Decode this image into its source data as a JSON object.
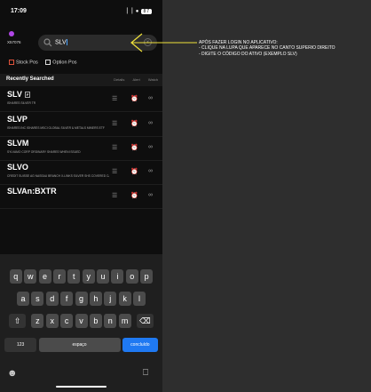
{
  "status": {
    "time": "17:09",
    "signal": "▕▕ ●",
    "battery": "87"
  },
  "account": {
    "number": "X57076"
  },
  "search": {
    "value": "SLV",
    "clear": "×"
  },
  "tabs": [
    {
      "label": "Stock Pos"
    },
    {
      "label": "Option Pos"
    }
  ],
  "recent": {
    "title": "Recently Searched",
    "col_details": "Details",
    "col_alert": "Alert",
    "col_watch": "Watch"
  },
  "rows": [
    {
      "symbol": "SLV",
      "desc": "ISHARES SILVER TR",
      "flag": "F"
    },
    {
      "symbol": "SLVP",
      "desc": "ISHARES INC ISHARES MSCI GLOBAL SILVER & METALS MINERS ETF"
    },
    {
      "symbol": "SLVM",
      "desc": "SYLVAMO CORP ORDINARY SHARES WHEN ISSUED"
    },
    {
      "symbol": "SLVO",
      "desc": "CREDIT SUISSE AG NASSAU BRANCH X-LINKS SILVER SHS COVERED CALL ETN"
    },
    {
      "symbol": "SLVAn:BXTR",
      "desc": ""
    }
  ],
  "keyboard": {
    "row1": [
      "q",
      "w",
      "e",
      "r",
      "t",
      "y",
      "u",
      "i",
      "o",
      "p"
    ],
    "row2": [
      "a",
      "s",
      "d",
      "f",
      "g",
      "h",
      "j",
      "k",
      "l"
    ],
    "row3": [
      "z",
      "x",
      "c",
      "v",
      "b",
      "n",
      "m"
    ],
    "shift": "⇧",
    "backspace": "⌫",
    "numbers": "123",
    "space": "espaço",
    "done": "concluído",
    "emoji": "☻",
    "mic": "⎕"
  },
  "annotation": {
    "line1": "APÓS FAZER LOGIN NO APLICATIVO:",
    "line2": "- CLIQUE NA LUPA QUE APARECE NO CANTO SUPERIO DIREITO",
    "line3": "- DIGITE O CÓDIGO DO ATIVO (EXEMPLO SLV)"
  },
  "colors": {
    "accent": "#1f79f2",
    "annotation": "#f0e23a",
    "brand": "#b046e6"
  }
}
